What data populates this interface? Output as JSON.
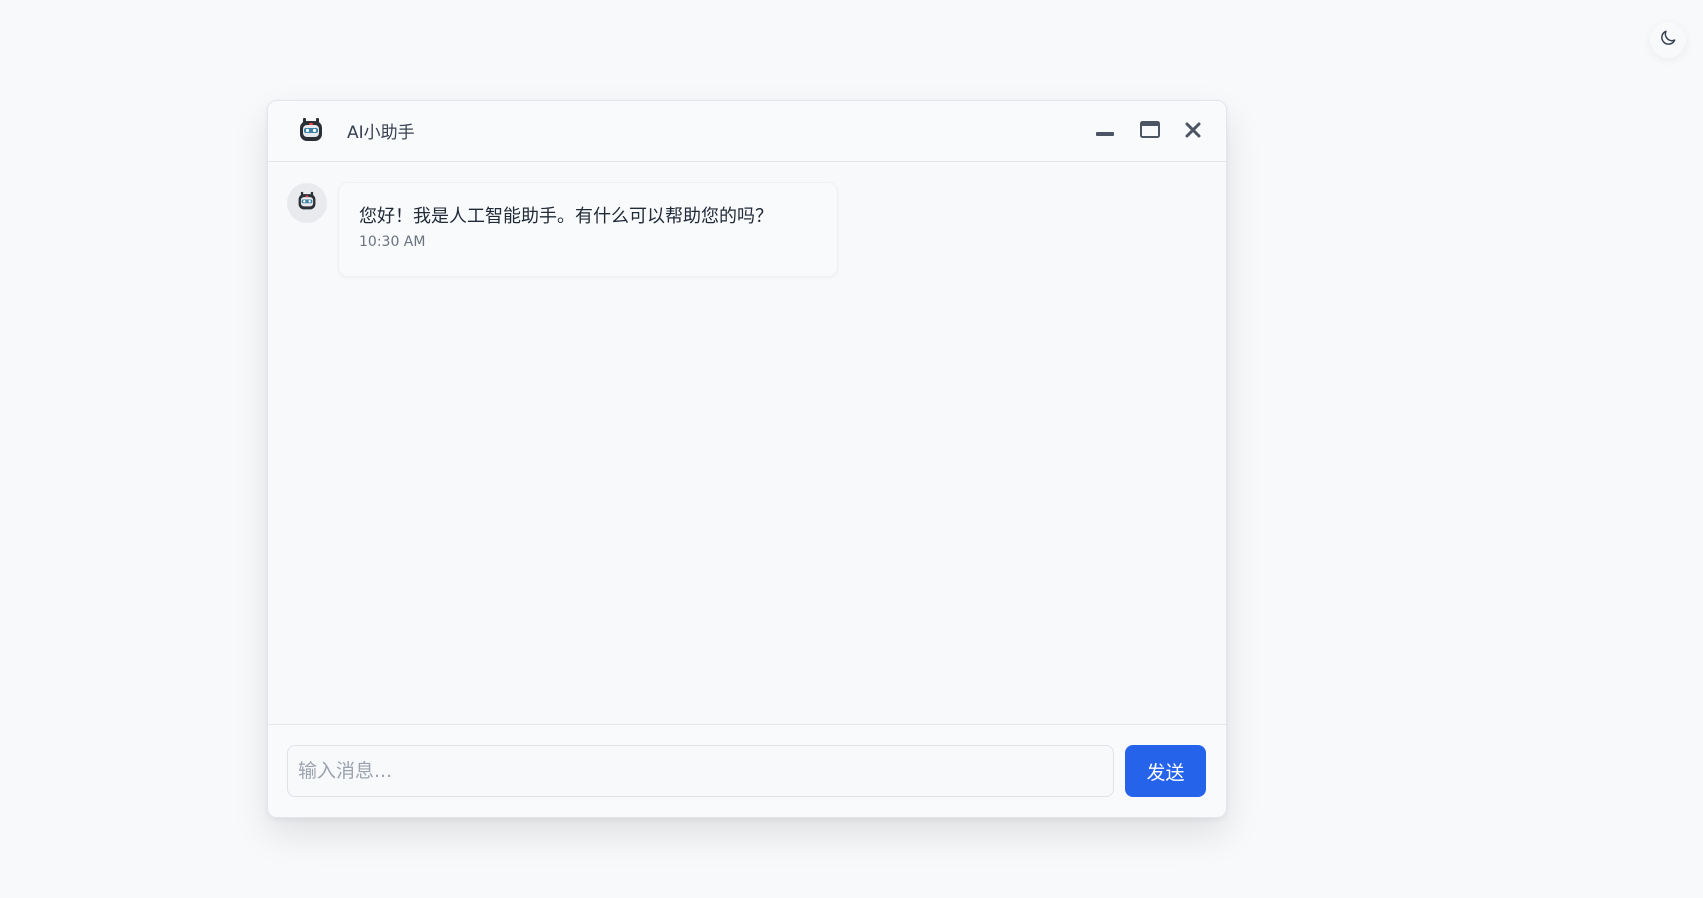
{
  "window": {
    "title": "AI小助手",
    "avatar_icon": "robot-avatar-icon",
    "controls": [
      "minimize-icon",
      "maximize-icon",
      "close-icon"
    ]
  },
  "messages": [
    {
      "sender": "assistant",
      "text": "您好！我是人工智能助手。有什么可以帮助您的吗？",
      "time": "10:30 AM"
    }
  ],
  "composer": {
    "placeholder": "输入消息...",
    "value": "",
    "send_label": "发送"
  },
  "theme_toggle": {
    "icon": "moon-icon"
  },
  "colors": {
    "background": "#f8f9fb",
    "accent": "#2563eb",
    "border": "#e3e6ea"
  }
}
